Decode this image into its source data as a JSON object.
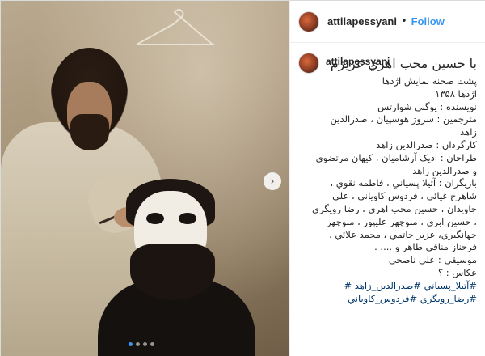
{
  "post": {
    "username": "attilapessyani",
    "follow_label": "Follow",
    "separator": "•",
    "caption_lines": [
      "با حسين محب اهري عزيزم",
      "پشت صحنه نمايش اژدها",
      "اژدها ١٣۵٨",
      "نويسنده : يوگني شوارتس",
      "مترجمين : سروژ هوسپيان ، صدرالدين",
      "زاهد",
      "كارگردان : صدرالدين زاهد",
      "طراحان : ادیک آرشاميان ، كيهان مرتضوي",
      "و صدرالدين زاهد",
      "بازيگران : آتيلا پسياني ، فاطمه نقوي ،",
      "شاهرخ غيائي ، فردوس كاوياني ، علي",
      "جاويدان ، حسين محب اهري ، رضا رويگري",
      "، حسين ابري ، منوچهر عليپور ، منوچهر",
      "جهانگيري، عزيز حاتمي ، محمد علائي ،",
      "فرحناز مناقي طاهر و .... .",
      "موسيقي : علي ناصحي",
      "عكاس : ؟"
    ],
    "hashtags_line1": "#آتيلا_پسياني #صدرالدين_زاهد #",
    "hashtags_line2": "#رضا_رويگري #فردوس_كاوياني",
    "carousel": {
      "total": 4,
      "active_index": 0
    },
    "icons": {
      "next": "chevron-right-icon",
      "avatar": "profile-avatar-icon"
    },
    "colors": {
      "accent": "#3897f0",
      "hashtag": "#00376b"
    }
  }
}
